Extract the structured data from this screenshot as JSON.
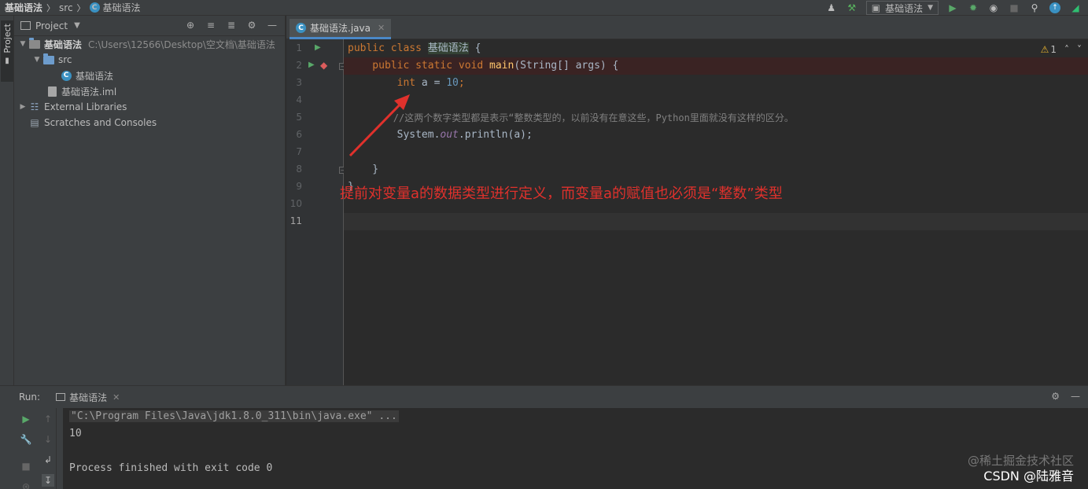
{
  "breadcrumb": [
    "基础语法",
    "src",
    "基础语法"
  ],
  "run_config": "基础语法",
  "project_panel": {
    "title": "Project",
    "tree": [
      {
        "label": "基础语法",
        "path": "C:\\Users\\12566\\Desktop\\空文档\\基础语法"
      },
      {
        "label": "src"
      },
      {
        "label": "基础语法"
      },
      {
        "label": "基础语法.iml"
      },
      {
        "label": "External Libraries"
      },
      {
        "label": "Scratches and Consoles"
      }
    ]
  },
  "left_strip": {
    "project_tab": "Project"
  },
  "editor": {
    "tab_label": "基础语法.java",
    "warning_count": "1",
    "line_numbers": [
      "1",
      "2",
      "3",
      "4",
      "5",
      "6",
      "7",
      "8",
      "9",
      "10",
      "11"
    ],
    "code": {
      "l1_kw": "public class ",
      "l1_name": "基础语法",
      "l1_end": " {",
      "l2_kw": "    public static void ",
      "l2_fn": "main",
      "l2_end": "(String[] args) {",
      "l3_kw": "        int",
      "l3_mid": " a = ",
      "l3_num": "10",
      "l3_end": ";",
      "l5_comment": "        //这两个数字类型都是表示“整数类型的，以前没有在意这些，Python里面就没有这样的区分。",
      "l6_a": "        System.",
      "l6_it": "out",
      "l6_b": ".println(a);",
      "l8": "    }",
      "l9": "}"
    },
    "annotation": "提前对变量a的数据类型进行定义，而变量a的赋值也必须是“整数”类型"
  },
  "run_panel": {
    "label": "Run:",
    "tab_label": "基础语法",
    "output": [
      "\"C:\\Program Files\\Java\\jdk1.8.0_311\\bin\\java.exe\" ...",
      "10",
      "",
      "Process finished with exit code 0"
    ]
  },
  "watermark": {
    "line1": "@稀土掘金技术社区",
    "line2": "CSDN @陆雅音"
  },
  "colors": {
    "keyword": "#cc7832",
    "function": "#ffc66d",
    "number": "#6897bb",
    "comment": "#808080",
    "annotation": "#e0312c"
  }
}
